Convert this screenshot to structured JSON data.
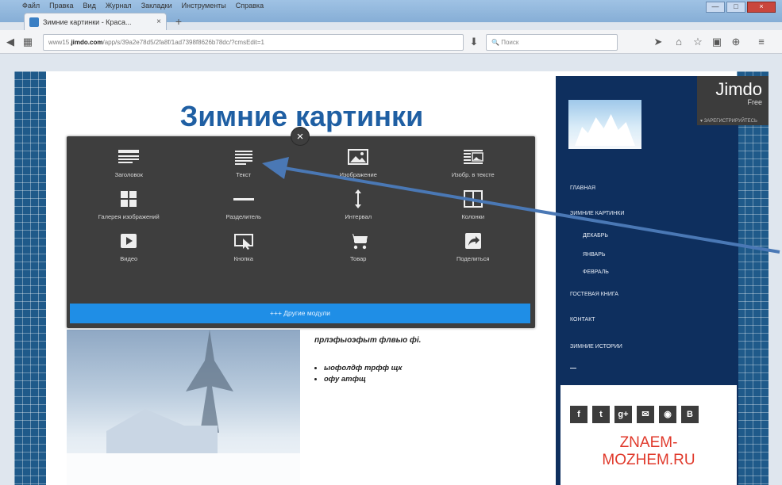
{
  "browser": {
    "menu": [
      "Файл",
      "Правка",
      "Вид",
      "Журнал",
      "Закладки",
      "Инструменты",
      "Справка"
    ],
    "tab_title": "Зимние картинки - Краса...",
    "tab_close": "×",
    "new_tab": "+",
    "url_prefix": "www15.",
    "url_host": "jimdo.com",
    "url_rest": "/app/s/39a2e78d5/2fa8f/1ad7398f8626b78dc/?cmsEdit=1",
    "search_placeholder": "Поиск",
    "win_min": "—",
    "win_max": "□",
    "win_close": "×"
  },
  "page": {
    "title": "Зимние картинки",
    "intro_text": "прлэфыоэфыт флвыо фі.",
    "bullets": [
      "ыофолдф трфф щк",
      "офу атфщ"
    ]
  },
  "module_panel": {
    "close_label": "×",
    "modules": [
      {
        "label": "Заголовок",
        "icon": "heading-icon"
      },
      {
        "label": "Текст",
        "icon": "text-icon"
      },
      {
        "label": "Изображение",
        "icon": "image-icon"
      },
      {
        "label": "Изобр. в тексте",
        "icon": "image-text-icon"
      },
      {
        "label": "Галерея изображений",
        "icon": "gallery-icon"
      },
      {
        "label": "Разделитель",
        "icon": "divider-icon"
      },
      {
        "label": "Интервал",
        "icon": "spacing-icon"
      },
      {
        "label": "Колонки",
        "icon": "columns-icon"
      },
      {
        "label": "Видео",
        "icon": "video-icon"
      },
      {
        "label": "Кнопка",
        "icon": "button-icon"
      },
      {
        "label": "Товар",
        "icon": "cart-icon"
      },
      {
        "label": "Поделиться",
        "icon": "share-icon"
      }
    ],
    "more_label": "+++ Другие модули"
  },
  "sidebar": {
    "jimdo_logo": "Jimdo",
    "jimdo_free": "Free",
    "jimdo_sub": "▾ ЗАРЕГИСТРИРУЙТЕСЬ",
    "nav": [
      {
        "label": "Главная",
        "sub": false
      },
      {
        "label": "Зимние картинки",
        "sub": false
      },
      {
        "label": "Декабрь",
        "sub": true
      },
      {
        "label": "Январь",
        "sub": true
      },
      {
        "label": "Февраль",
        "sub": true
      },
      {
        "label": "Гостевая книга",
        "sub": false
      },
      {
        "label": "Контакт",
        "sub": false
      },
      {
        "label": "Зимние истории",
        "sub": false
      }
    ],
    "social": [
      "f",
      "t",
      "g+",
      "✉",
      "◉",
      "B"
    ],
    "watermark_line1": "ZNAEM-",
    "watermark_line2": "MOZHEM.RU"
  },
  "colors": {
    "title_blue": "#1f5fa3",
    "panel_bg": "#3e3e3e",
    "button_blue": "#1f8ee6",
    "sidebar_navy": "#0e2f5e",
    "arrow": "#4a78b5"
  }
}
